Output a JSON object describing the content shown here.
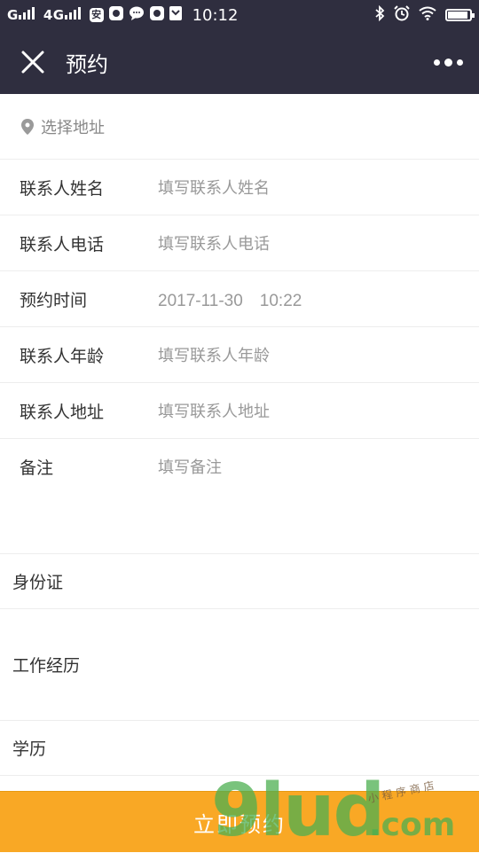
{
  "status_bar": {
    "signal_1": "G",
    "signal_2": "4G",
    "app_icon_1": "安",
    "time": "10:12",
    "icons": [
      "signal-icon",
      "notification-icon",
      "chat-icon",
      "bluetooth-icon",
      "alarm-icon",
      "wifi-icon",
      "battery-icon"
    ]
  },
  "nav": {
    "title": "预约",
    "close_icon": "close-icon",
    "more_icon": "more-icon"
  },
  "address": {
    "placeholder": "选择地址",
    "icon": "location-pin-icon"
  },
  "form": {
    "rows": [
      {
        "label": "联系人姓名",
        "value": "填写联系人姓名"
      },
      {
        "label": "联系人电话",
        "value": "填写联系人电话"
      },
      {
        "label": "预约时间",
        "value": "2017-11-30　10:22"
      },
      {
        "label": "联系人年龄",
        "value": "填写联系人年龄"
      },
      {
        "label": "联系人地址",
        "value": "填写联系人地址"
      }
    ],
    "note": {
      "label": "备注",
      "placeholder": "填写备注"
    }
  },
  "sections": {
    "id_card": "身份证",
    "work_history": "工作经历",
    "education": "学历"
  },
  "submit": {
    "label": "立即预约"
  },
  "watermark": {
    "main": "9lud",
    "suffix": ".com",
    "tag": "小程序商店"
  },
  "colors": {
    "header_bg": "#2f2e3f",
    "button_bg": "#f9a825",
    "placeholder": "#999999"
  }
}
